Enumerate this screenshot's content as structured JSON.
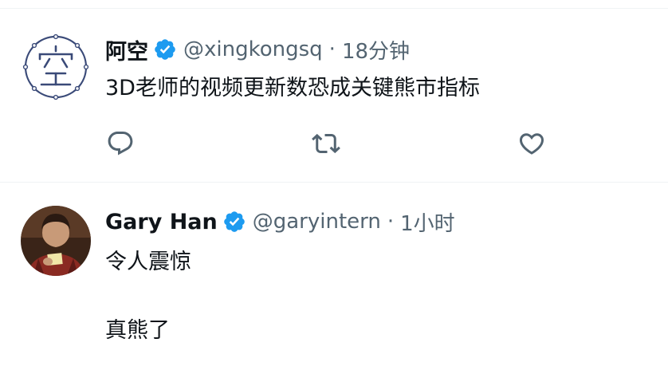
{
  "tweets": [
    {
      "display_name": "阿空",
      "handle": "@xingkongsq",
      "separator": "·",
      "time": "18分钟",
      "text": "3D老师的视频更新数恐成关键熊市指标",
      "avatar_icon": "kong-character-logo",
      "verified": true
    },
    {
      "display_name": "Gary Han",
      "handle": "@garyintern",
      "separator": "·",
      "time": "1小时",
      "text_lines": [
        "令人震惊",
        "真熊了"
      ],
      "avatar_icon": "user-photo",
      "verified": true
    }
  ],
  "colors": {
    "verified_blue": "#1d9bf0",
    "secondary_text": "#536471",
    "icon_gray": "#536471",
    "divider": "#eff3f4",
    "logo_navy": "#3a4a78"
  }
}
